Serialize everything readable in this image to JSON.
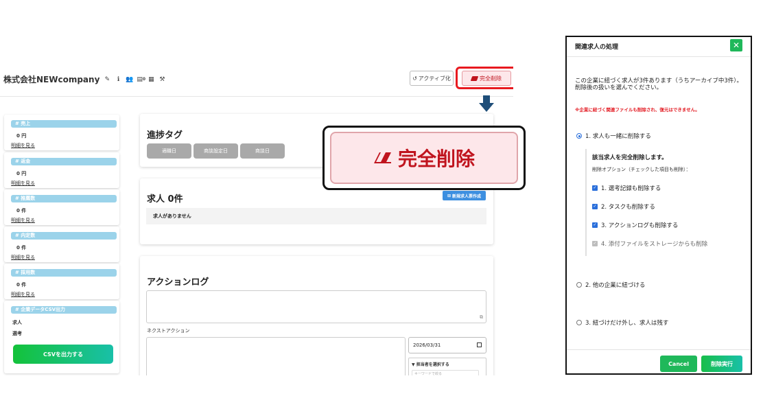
{
  "header": {
    "company_name": "株式会社NEWcompany",
    "doc_badge_count": "0",
    "active_button": "アクティブ化",
    "delete_button": "完全削除"
  },
  "sidebar": {
    "cards": [
      {
        "tag": "# 売上",
        "value": "0 円",
        "link": "明細を見る"
      },
      {
        "tag": "# 返金",
        "value": "0 円",
        "link": "明細を見る"
      },
      {
        "tag": "# 推薦数",
        "value": "0 件",
        "link": "明細を見る"
      },
      {
        "tag": "# 内定数",
        "value": "0 件",
        "link": "明細を見る"
      },
      {
        "tag": "# 採用数",
        "value": "0 件",
        "link": "明細を見る"
      }
    ],
    "csv": {
      "tag": "# 企業データCSV出力",
      "items": [
        "求人",
        "選考"
      ],
      "button": "CSVを出力する"
    }
  },
  "progress": {
    "title": "進捗タグ",
    "tags": [
      "適職日",
      "商談設定日",
      "商談日"
    ]
  },
  "jobs": {
    "title": "求人 0件",
    "new_button": "新規求人票作成",
    "empty": "求人がありません"
  },
  "action_log": {
    "title": "アクションログ",
    "next_action_label": "ネクストアクション",
    "date": "2026/03/31",
    "assignee_title": "▼ 担当者を選択する",
    "assignee_placeholder": "キーワードで絞る"
  },
  "zoom": {
    "label": "完全削除"
  },
  "modal": {
    "title": "関連求人の処理",
    "close": "✕",
    "description": "この企業に紐づく求人が3件あります（うちアーカイブ中3件）。削除後の扱いを選んでください。",
    "warning": "※企業に紐づく関連ファイルも削除され、復元はできません。",
    "options": [
      {
        "label": "1. 求人も一緒に削除する",
        "selected": true
      },
      {
        "label": "2. 他の企業に紐づける",
        "selected": false
      },
      {
        "label": "3. 紐づけだけ外し、求人は残す",
        "selected": false
      }
    ],
    "sub": {
      "title": "該当求人を完全削除します。",
      "note": "削除オプション（チェックした項目も削除）：",
      "checks": [
        {
          "label": "1. 選考記録も削除する",
          "checked": true,
          "disabled": false
        },
        {
          "label": "2. タスクも削除する",
          "checked": true,
          "disabled": false
        },
        {
          "label": "3. アクションログも削除する",
          "checked": true,
          "disabled": false
        },
        {
          "label": "4. 添付ファイルをストレージからも削除",
          "checked": true,
          "disabled": true
        }
      ]
    },
    "cancel_button": "Cancel",
    "execute_button": "削除実行"
  },
  "colors": {
    "accent_green": "#1fb85a",
    "danger_red": "#e8191f",
    "tag_blue": "#9bd3ea",
    "primary_blue": "#2a6fdb"
  }
}
